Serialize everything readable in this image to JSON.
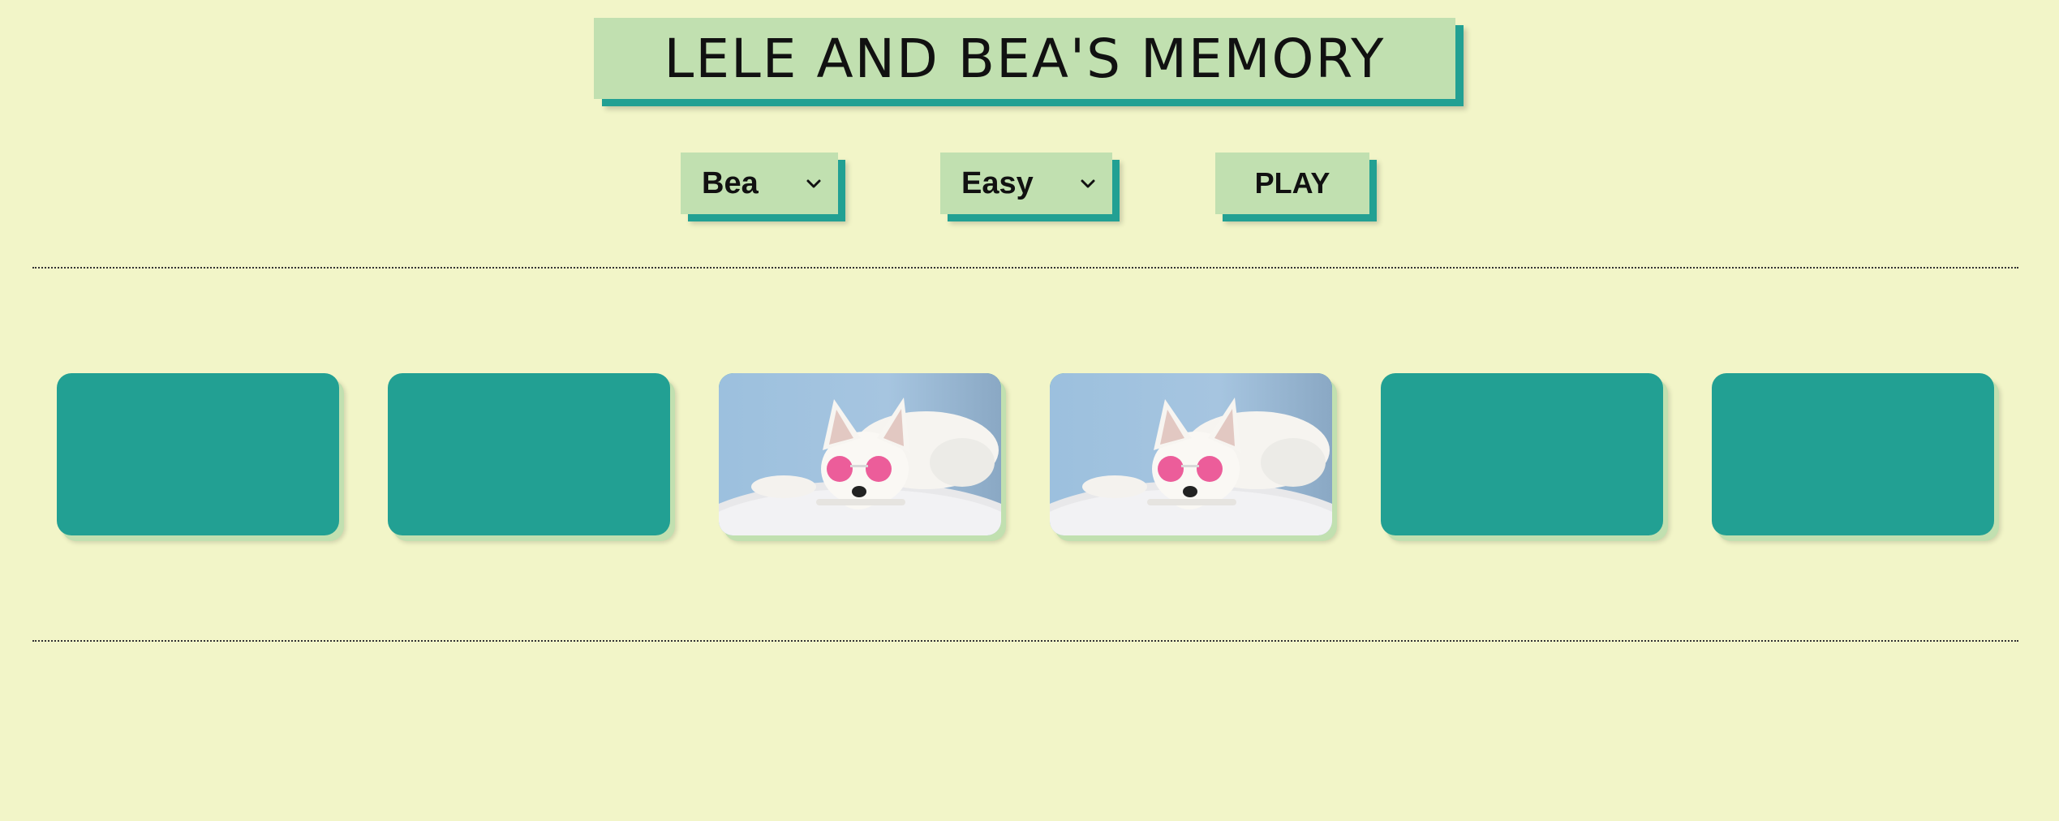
{
  "header": {
    "title": "LELE AND BEA'S MEMORY"
  },
  "controls": {
    "player_select": {
      "selected": "Bea"
    },
    "difficulty_select": {
      "selected": "Easy"
    },
    "play_label": "PLAY"
  },
  "colors": {
    "background": "#f2f5c8",
    "panel": "#c1e0b0",
    "accent": "#22a093",
    "card_back": "#22a093"
  },
  "board": {
    "cards": [
      {
        "state": "face-down"
      },
      {
        "state": "face-down"
      },
      {
        "state": "face-up",
        "image": "white-dog-heart-sunglasses"
      },
      {
        "state": "face-up",
        "image": "white-dog-heart-sunglasses"
      },
      {
        "state": "face-down"
      },
      {
        "state": "face-down"
      }
    ]
  }
}
